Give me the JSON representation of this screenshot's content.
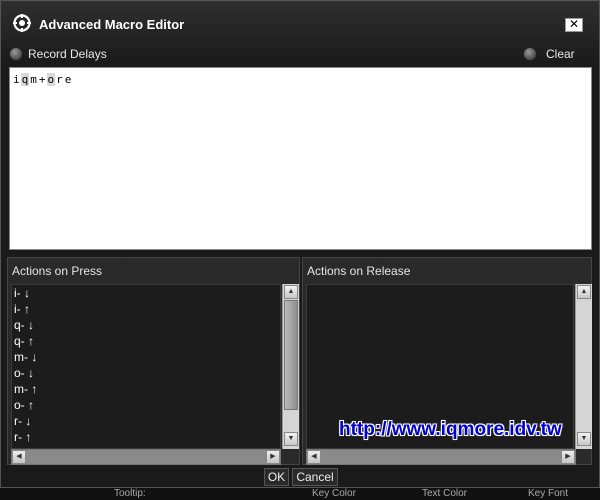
{
  "window": {
    "title": "Advanced Macro Editor",
    "close_label": "✕"
  },
  "options": {
    "record_delays": "Record Delays",
    "clear": "Clear"
  },
  "editor": {
    "chars": [
      "i",
      "q",
      "m",
      "+",
      "o",
      "r",
      "e"
    ],
    "highlighted": [
      false,
      true,
      false,
      false,
      true,
      false,
      false
    ]
  },
  "press_panel": {
    "title": "Actions on Press",
    "items": [
      "i- ↓",
      "i- ↑",
      "q- ↓",
      "q- ↑",
      "m- ↓",
      "o- ↓",
      "m- ↑",
      "o- ↑",
      "r- ↓",
      "r- ↑"
    ]
  },
  "release_panel": {
    "title": "Actions on Release",
    "items": []
  },
  "watermark": "http://www.iqmore.idv.tw",
  "buttons": {
    "ok": "OK",
    "cancel": "Cancel"
  },
  "background_app": {
    "tooltip": "Tooltip:",
    "key_color": "Key Color",
    "text_color": "Text Color",
    "key_font": "Key Font"
  }
}
